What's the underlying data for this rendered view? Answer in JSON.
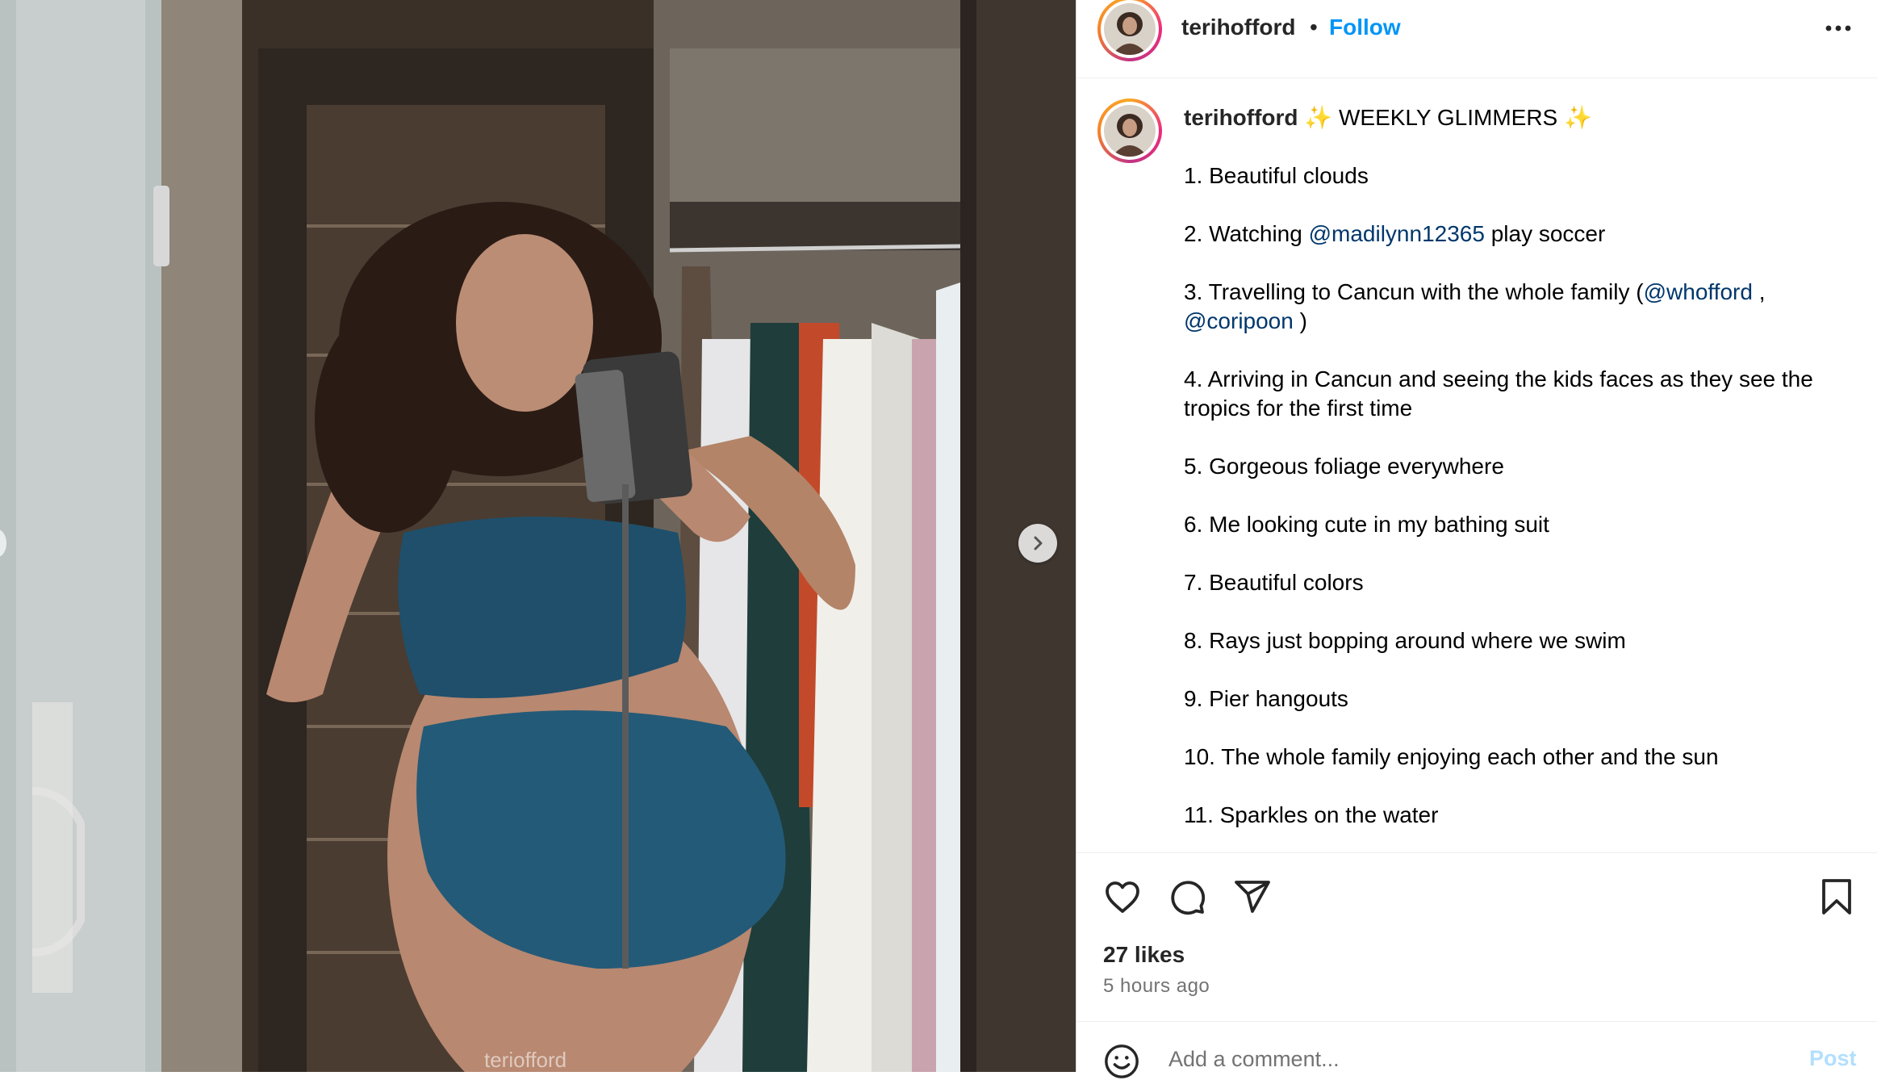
{
  "colors": {
    "link": "#0095f6",
    "mention": "#00376b",
    "muted": "#737373",
    "sparkle": "#f3c45a"
  },
  "media": {
    "next_icon": "chevron-right-icon",
    "watermark": "teriofford"
  },
  "header": {
    "username": "terihofford",
    "separator": "•",
    "follow_label": "Follow",
    "more_icon": "more-horizontal-icon"
  },
  "caption": {
    "username": "terihofford",
    "sparkle": "✨",
    "title": "WEEKLY GLIMMERS",
    "items": {
      "i1": "1. Beautiful clouds",
      "i2_pre": "2. Watching ",
      "i2_mention": "@madilynn12365",
      "i2_post": " play soccer",
      "i3_pre": "3. Travelling to Cancun with the whole family (",
      "i3_mention1": "@whofford",
      "i3_mid": " ,",
      "i3_mention2": "@coripoon",
      "i3_post": " )",
      "i4": "4. Arriving in Cancun and seeing the kids faces as they see the tropics for the first time",
      "i5": "5. Gorgeous foliage everywhere",
      "i6": "6. Me looking cute in my bathing suit",
      "i7": "7. Beautiful colors",
      "i8": "8. Rays just bopping around where we swim",
      "i9": "9. Pier hangouts",
      "i10": "10. The whole family enjoying each other and the sun",
      "i11": "11. Sparkles on the water"
    }
  },
  "actions": {
    "like_icon": "heart-icon",
    "comment_icon": "comment-icon",
    "share_icon": "share-icon",
    "save_icon": "bookmark-icon",
    "likes": "27 likes",
    "time": "5 hours ago"
  },
  "comment": {
    "emoji_icon": "emoji-icon",
    "placeholder": "Add a comment...",
    "post_label": "Post"
  }
}
